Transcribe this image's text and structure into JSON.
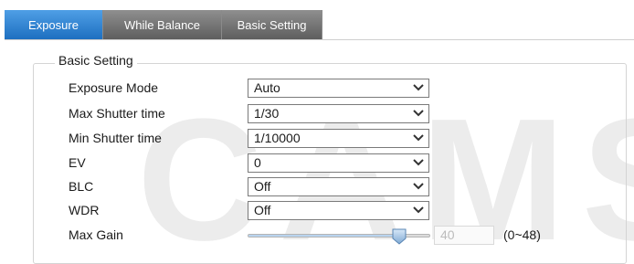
{
  "tabs": [
    {
      "label": "Exposure",
      "active": true
    },
    {
      "label": "While Balance",
      "active": false
    },
    {
      "label": "Basic Setting",
      "active": false
    }
  ],
  "section": {
    "legend": "Basic Setting"
  },
  "fields": {
    "exposure_mode": {
      "label": "Exposure Mode",
      "value": "Auto"
    },
    "max_shutter": {
      "label": "Max Shutter time",
      "value": "1/30"
    },
    "min_shutter": {
      "label": "Min Shutter time",
      "value": "1/10000"
    },
    "ev": {
      "label": "EV",
      "value": "0"
    },
    "blc": {
      "label": "BLC",
      "value": "Off"
    },
    "wdr": {
      "label": "WDR",
      "value": "Off"
    }
  },
  "max_gain": {
    "label": "Max Gain",
    "value": "40",
    "range_text": "(0~48)",
    "min": 0,
    "max": 48,
    "current": 40
  },
  "watermark": {
    "text": "CAMSECU"
  },
  "colors": {
    "tab_active": "#1d6fc0",
    "tab_inactive": "#6f6f6f",
    "watermark": "#ececec"
  }
}
